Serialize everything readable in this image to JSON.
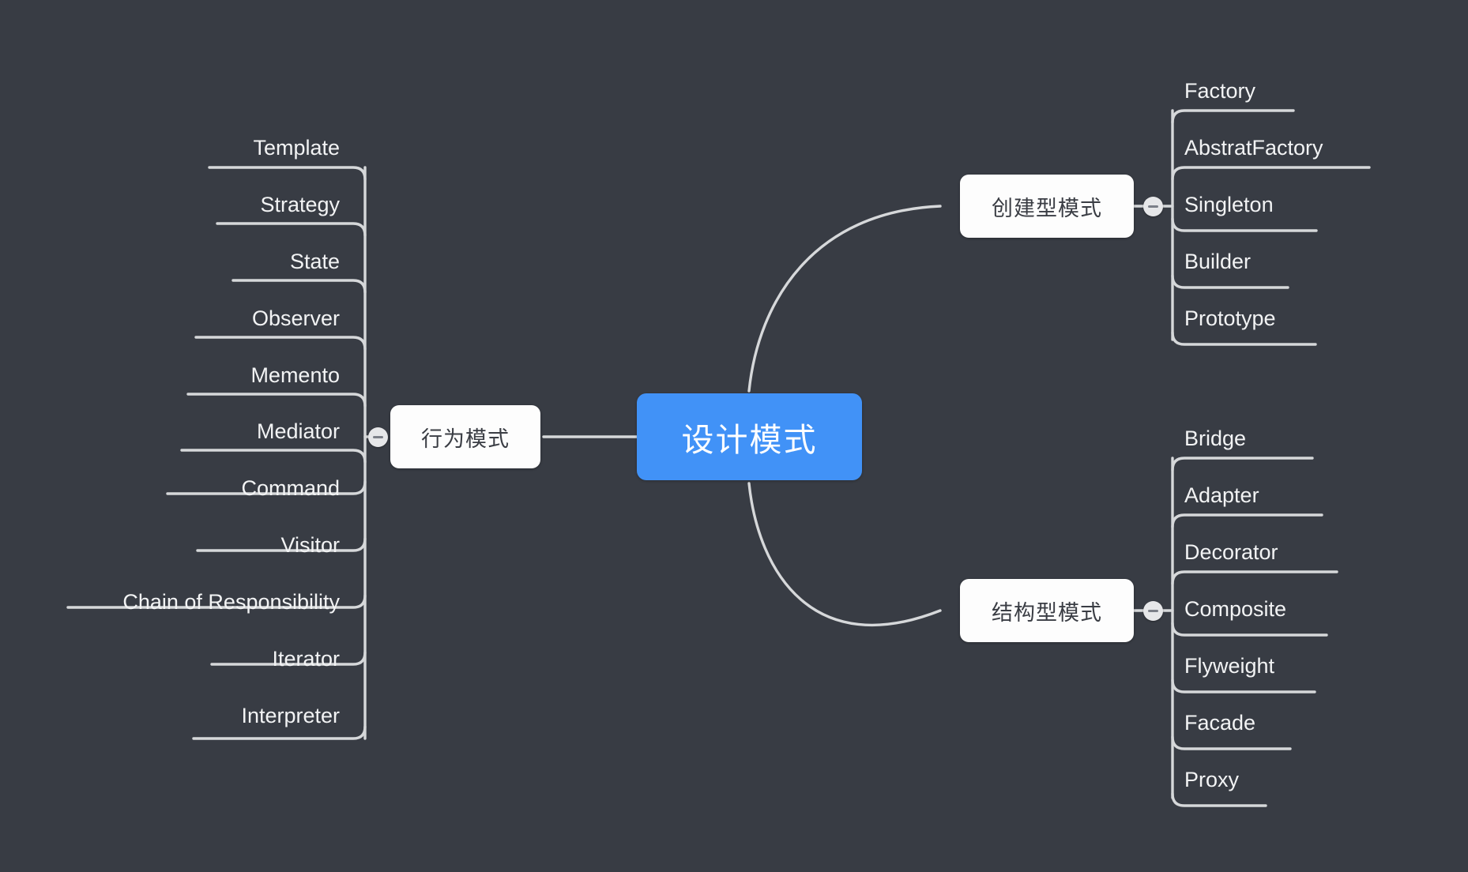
{
  "theme": {
    "background": "#383c44",
    "root_fill": "#4192f7",
    "root_text": "#ffffff",
    "branch_fill": "#fdfdfd",
    "branch_text": "#3a3d44",
    "line": "#d6d8da",
    "leaf_text": "#f2f3f4",
    "toggle_fill": "#e6e7e9",
    "toggle_glyph": "#7b7f88"
  },
  "mindmap": {
    "root": {
      "label": "设计模式"
    },
    "branches": [
      {
        "id": "behavioral",
        "label": "行为模式",
        "side": "left",
        "collapse_icon": "minus-icon",
        "collapsed": false,
        "children": [
          {
            "label": "Template"
          },
          {
            "label": "Strategy"
          },
          {
            "label": "State"
          },
          {
            "label": "Observer"
          },
          {
            "label": "Memento"
          },
          {
            "label": "Mediator"
          },
          {
            "label": "Command"
          },
          {
            "label": "Visitor"
          },
          {
            "label": "Chain of Responsibility"
          },
          {
            "label": "Iterator"
          },
          {
            "label": "Interpreter"
          }
        ]
      },
      {
        "id": "creational",
        "label": "创建型模式",
        "side": "right",
        "collapse_icon": "minus-icon",
        "collapsed": false,
        "children": [
          {
            "label": "Factory"
          },
          {
            "label": "AbstratFactory"
          },
          {
            "label": "Singleton"
          },
          {
            "label": "Builder"
          },
          {
            "label": "Prototype"
          }
        ]
      },
      {
        "id": "structural",
        "label": "结构型模式",
        "side": "right",
        "collapse_icon": "minus-icon",
        "collapsed": false,
        "children": [
          {
            "label": "Bridge"
          },
          {
            "label": "Adapter"
          },
          {
            "label": "Decorator"
          },
          {
            "label": "Composite"
          },
          {
            "label": "Flyweight"
          },
          {
            "label": "Facade"
          },
          {
            "label": "Proxy"
          }
        ]
      }
    ]
  }
}
